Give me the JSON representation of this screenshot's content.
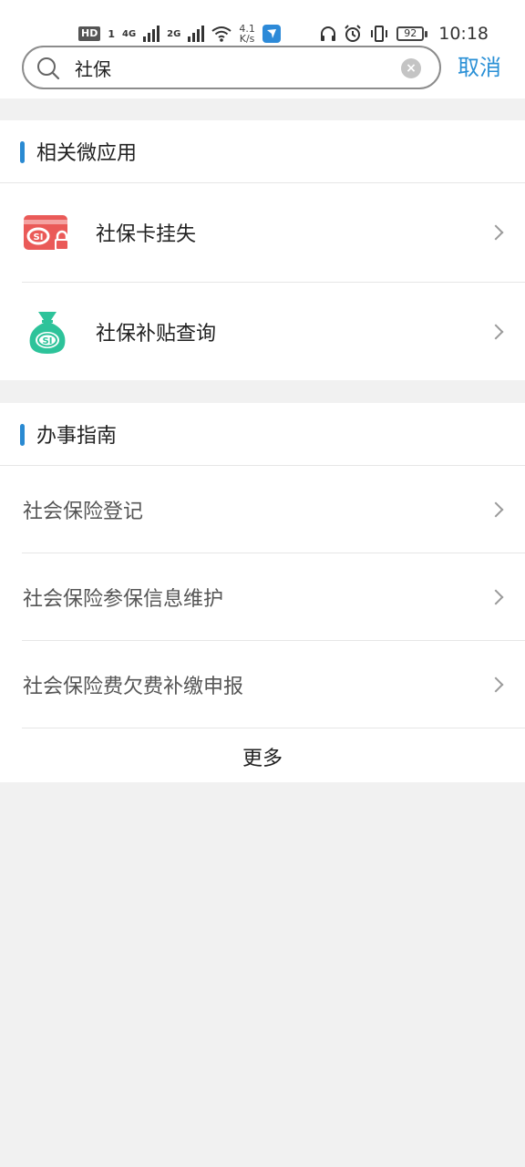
{
  "statusbar": {
    "hd": "HD",
    "sim1": "1",
    "net1": "4G",
    "net2": "2G",
    "speed_value": "4.1",
    "speed_unit": "K/s",
    "battery": "92",
    "time": "10:18"
  },
  "search": {
    "value": "社保",
    "cancel_label": "取消"
  },
  "apps_section": {
    "title": "相关微应用",
    "items": [
      {
        "label": "社保卡挂失",
        "icon": "lock-card-icon",
        "color": "#ea5a58"
      },
      {
        "label": "社保补贴查询",
        "icon": "money-bag-icon",
        "color": "#2dc39a"
      }
    ]
  },
  "guide_section": {
    "title": "办事指南",
    "items": [
      {
        "label": "社会保险登记"
      },
      {
        "label": "社会保险参保信息维护"
      },
      {
        "label": "社会保险费欠费补缴申报"
      }
    ],
    "more_label": "更多"
  },
  "colors": {
    "accent": "#2a90d6",
    "section_bar": "#2a8ad2",
    "background": "#f1f1f1"
  }
}
